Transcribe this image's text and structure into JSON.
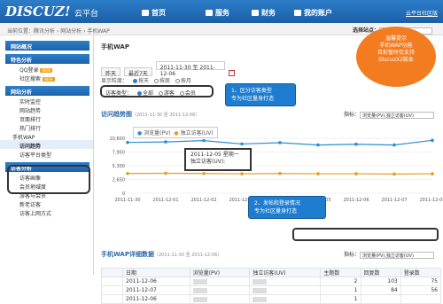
{
  "header": {
    "logo": "DISCUZ!",
    "logo_suffix": "云平台",
    "nav": [
      {
        "label": "首页",
        "icon": "home-icon"
      },
      {
        "label": "服务",
        "icon": "gear-icon"
      },
      {
        "label": "财务",
        "icon": "finance-icon"
      },
      {
        "label": "我的账户",
        "icon": "user-icon"
      }
    ],
    "top_link": "云平台社区版"
  },
  "breadcrumb": "当前位置：腾讯分析 › 网站分析 › 手机WAP",
  "site_select": {
    "label": "选择站点："
  },
  "sidebar": {
    "overview": "网站概况",
    "feature_title": "特色分析",
    "feature_items": [
      {
        "label": "QQ登录",
        "badge": "NEW"
      },
      {
        "label": "社区搜索",
        "badge": "NEW"
      }
    ],
    "site_title": "网站分析",
    "site_items": [
      "实时监控",
      "网站趋势",
      "页面排行",
      "热门排行"
    ],
    "wap_label": "手机WAP",
    "wap_items": [
      "访问趋势",
      "访客平台类型"
    ],
    "visitor_title": "访客分析",
    "visitor_items": [
      "访客画像",
      "会员地域度",
      "游客与会员",
      "新老访客",
      "访客上网方式"
    ]
  },
  "main": {
    "title": "手机WAP",
    "range_buttons": [
      "昨天",
      "最近7天"
    ],
    "date_range": "2011-11-30 至 2011-12-06",
    "display_label": "显示粒度：",
    "display_opts": [
      "按天",
      "按周",
      "按月"
    ],
    "type_label": "访客类型：",
    "type_opts": [
      "全部",
      "游客",
      "会员"
    ],
    "trend_title": "访问趋势图",
    "trend_range": "（2011-11-30 至 2011-12-06）",
    "indicator_label": "指标：",
    "indicator_value": "浏览量(PV),独立访客(UV)",
    "detail_title": "手机WAP详细数据",
    "detail_range": "（2011-11-30 至 2011-12-06）",
    "detail_indicator": "浏览量(PV),独立访客(UV)"
  },
  "callouts": {
    "one": "1、区分访客类型\n专为社区量身打造",
    "two": "2、发帖和登录情况\n专为社区量身打造",
    "blob": "温馨提示\n手机WAP功能\n目前暂时仅支持\nDiscuzX2版本"
  },
  "tooltip": {
    "line1": "2011-12-05 星期一",
    "line2": "独立访客(UV):"
  },
  "chart_data": {
    "type": "line",
    "categories": [
      "2011-11-30",
      "2011-12-01",
      "2011-12-02",
      "2011-12-03",
      "2011-12-04",
      "2011-12-05",
      "2011-12-06",
      "2011-12-07",
      "2011-12-08"
    ],
    "series": [
      {
        "name": "浏览量(PV)",
        "values": [
          9800,
          9900,
          10150,
          9500,
          9750,
          9300,
          9450,
          9300,
          10200
        ],
        "color": "#2d8fd0"
      },
      {
        "name": "独立访客(UV)",
        "values": [
          3800,
          3850,
          3800,
          3750,
          3800,
          3750,
          3750,
          3700,
          3750
        ],
        "color": "#e0a020"
      }
    ],
    "yticks": [
      "10,600",
      "7,950",
      "5,300",
      "2,650",
      "0"
    ],
    "ylim": [
      0,
      10600
    ]
  },
  "table": {
    "headers": [
      "日期",
      "浏览量(PV)",
      "独立访客(UV)",
      "主题数",
      "回复数",
      "登录数"
    ],
    "rows": [
      {
        "date": "2011-12-06",
        "topics": "2",
        "replies": "103",
        "logins": "75"
      },
      {
        "date": "2011-12-07",
        "topics": "1",
        "replies": "84",
        "logins": "56"
      },
      {
        "date": "2011-12-06",
        "topics": "1",
        "replies": "",
        "logins": ""
      }
    ]
  }
}
